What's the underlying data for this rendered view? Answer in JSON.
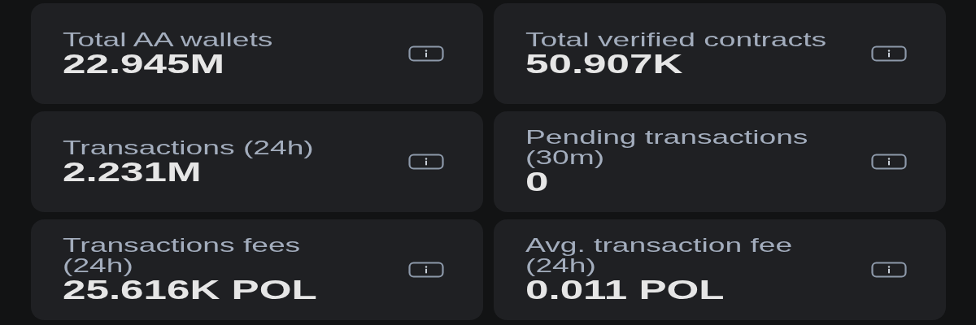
{
  "stats": [
    {
      "label": "Total AA wallets",
      "value": "22.945M"
    },
    {
      "label": "Total verified contracts",
      "value": "50.907K"
    },
    {
      "label": "Transactions (24h)",
      "value": "2.231M"
    },
    {
      "label": "Pending transactions (30m)",
      "value": "0"
    },
    {
      "label": "Transactions fees (24h)",
      "value": "25.616K POL"
    },
    {
      "label": "Avg. transaction fee (24h)",
      "value": "0.011 POL"
    }
  ]
}
